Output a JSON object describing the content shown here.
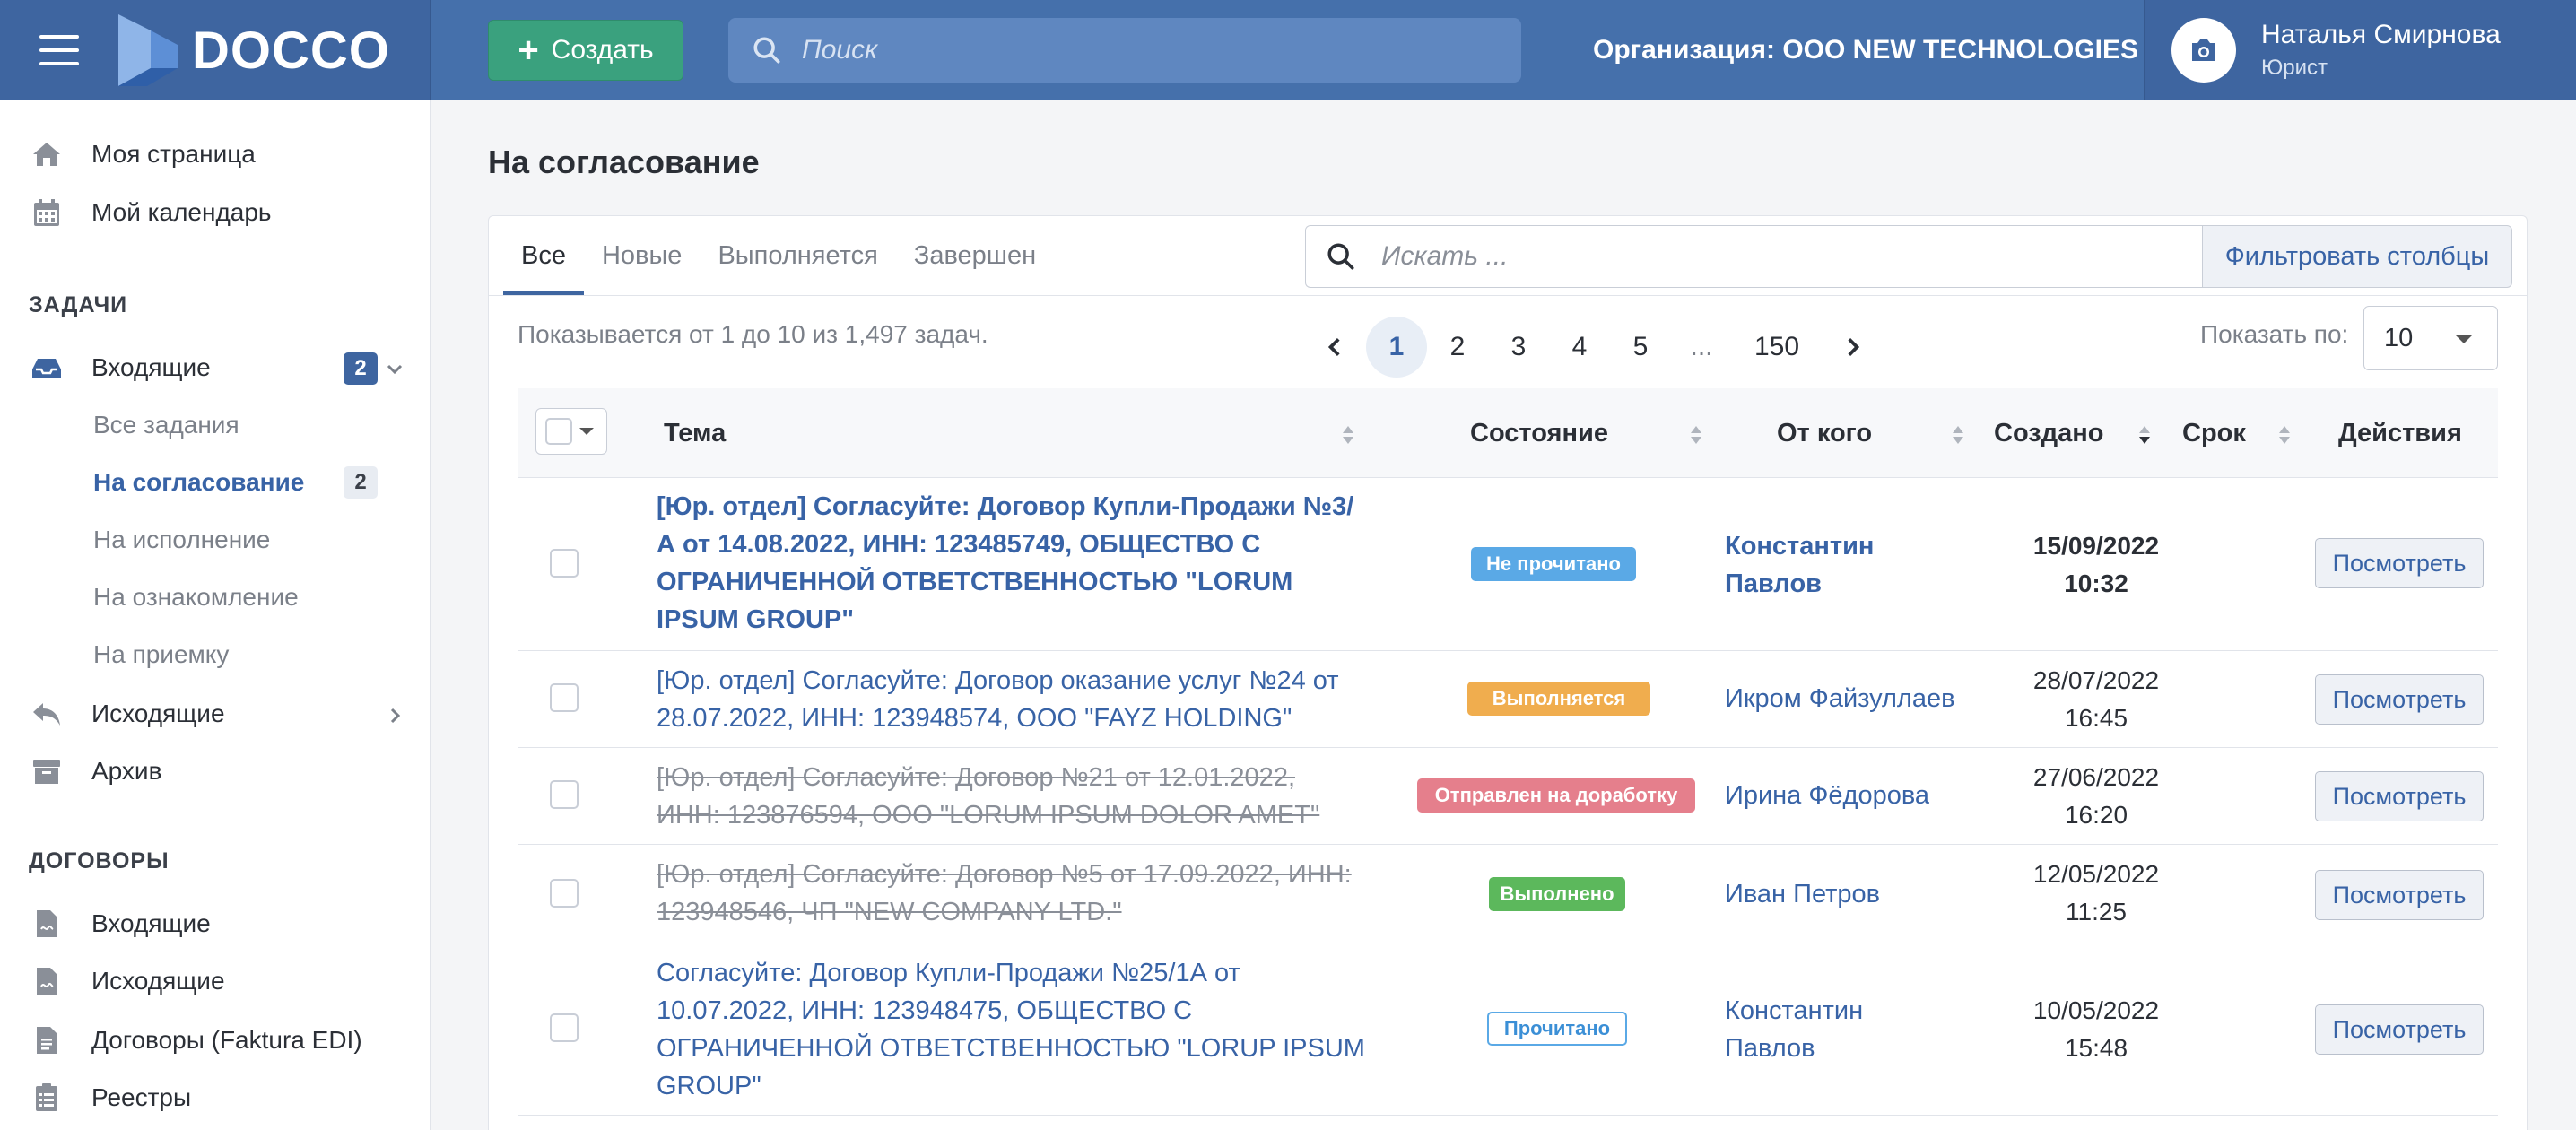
{
  "header": {
    "logo_text": "DOCCO",
    "create_label": "Создать",
    "search_placeholder": "Поиск",
    "organization": "Организация: ООО NEW TECHNOLOGIES",
    "user_name": "Наталья Смирнова",
    "user_role": "Юрист"
  },
  "sidebar": {
    "top_items": [
      {
        "label": "Моя страница",
        "icon": "home-icon"
      },
      {
        "label": "Мой календарь",
        "icon": "calendar-icon"
      }
    ],
    "tasks_title": "ЗАДАЧИ",
    "inbox": {
      "label": "Входящие",
      "badge": "2"
    },
    "inbox_sub": [
      {
        "label": "Все задания"
      },
      {
        "label": "На согласование",
        "badge": "2"
      },
      {
        "label": "На исполнение"
      },
      {
        "label": "На ознакомление"
      },
      {
        "label": "На приемку"
      }
    ],
    "outgoing": {
      "label": "Исходящие"
    },
    "archive": {
      "label": "Архив"
    },
    "contracts_title": "ДОГОВОРЫ",
    "contracts": [
      {
        "label": "Входящие"
      },
      {
        "label": "Исходящие"
      },
      {
        "label": "Договоры (Faktura EDI)"
      },
      {
        "label": "Реестры"
      }
    ]
  },
  "main": {
    "title": "На согласование",
    "tabs": [
      {
        "label": "Все",
        "active": true
      },
      {
        "label": "Новые"
      },
      {
        "label": "Выполняется"
      },
      {
        "label": "Завершен"
      }
    ],
    "search_placeholder": "Искать ...",
    "filter_label": "Фильтровать столбцы",
    "showing_text": "Показывается от 1 до 10 из 1,497 задач.",
    "pages": [
      "1",
      "2",
      "3",
      "4",
      "5",
      "...",
      "150"
    ],
    "current_page": "1",
    "per_page_label": "Показать по:",
    "per_page_value": "10",
    "columns": {
      "subject": "Тема",
      "status": "Состояние",
      "from": "От кого",
      "created": "Создано",
      "deadline": "Срок",
      "actions": "Действия"
    },
    "view_label": "Посмотреть",
    "rows": [
      {
        "subject": "[Юр. отдел] Согласуйте: Договор Купли-Продажи №3/А от 14.08.2022, ИНН: 123485749, ОБЩЕСТВО С ОГРАНИЧЕННОЙ ОТВЕТСТВЕННОСТЬЮ \"LORUM IPSUM GROUP\"",
        "status": "Не прочитано",
        "status_color": "#5aa9e6",
        "from": "Константин Павлов",
        "created_date": "15/09/2022",
        "created_time": "10:32"
      },
      {
        "subject": "[Юр. отдел] Согласуйте: Договор оказание услуг №24 от 28.07.2022, ИНН: 123948574, ООО \"FAYZ HOLDING\"",
        "status": "Выполняется",
        "status_color": "#f0ad4e",
        "from": "Икром Файзуллаев",
        "created_date": "28/07/2022",
        "created_time": "16:45"
      },
      {
        "subject": "[Юр. отдел] Согласуйте: Договор №21 от 12.01.2022, ИНН: 123876594, ООО \"LORUM IPSUM DOLOR AMET\"",
        "status": "Отправлен на доработку",
        "status_color": "#e57f8c",
        "from": "Ирина Фёдорова",
        "created_date": "27/06/2022",
        "created_time": "16:20"
      },
      {
        "subject": "[Юр. отдел] Согласуйте: Договор №5 от 17.09.2022, ИНН: 123948546, ЧП \"NEW COMPANY LTD.\"",
        "status": "Выполнено",
        "status_color": "#5cb85c",
        "from": "Иван Петров",
        "created_date": "12/05/2022",
        "created_time": "11:25"
      },
      {
        "subject": "Согласуйте: Договор Купли-Продажи №25/1А от 10.07.2022, ИНН: 123948475, ОБЩЕСТВО С ОГРАНИЧЕННОЙ ОТВЕТСТВЕННОСТЬЮ \"LORUP IPSUM GROUP\"",
        "status": "Прочитано",
        "status_color": "#5aa9e6",
        "from": "Константин Павлов",
        "created_date": "10/05/2022",
        "created_time": "15:48"
      }
    ]
  }
}
